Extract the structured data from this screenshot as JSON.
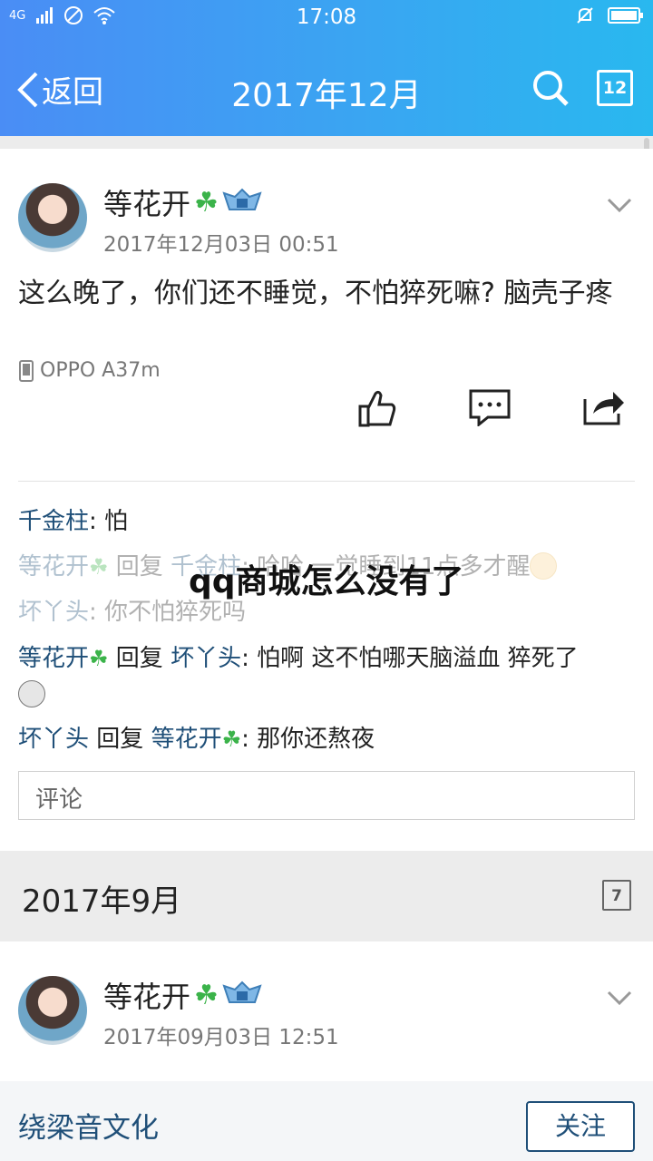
{
  "status_bar": {
    "network": "4G",
    "time": "17:08"
  },
  "nav": {
    "back_label": "返回",
    "title": "2017年12月",
    "calendar_day": "12"
  },
  "post1": {
    "author": "等花开",
    "timestamp": "2017年12月03日 00:51",
    "text": "这么晚了，你们还不睡觉，不怕猝死嘛? 脑壳子疼",
    "device": "OPPO A37m",
    "comments": [
      {
        "author": "千金柱",
        "sep": ": ",
        "text": "怕"
      },
      {
        "author": "等花开",
        "reply_word": "回复",
        "reply_to": "千金柱",
        "sep": ": ",
        "text": "哈哈 一觉睡到11点多才醒"
      },
      {
        "author": "坏丫头",
        "sep": ": ",
        "text": "你不怕猝死吗"
      },
      {
        "author": "等花开",
        "reply_word": "回复",
        "reply_to": "坏丫头",
        "sep": ": ",
        "text": "怕啊 这不怕哪天脑溢血 猝死了"
      },
      {
        "author": "坏丫头",
        "reply_word": "回复",
        "reply_to": "等花开",
        "sep": ": ",
        "text": "那你还熬夜"
      }
    ],
    "comment_placeholder": "评论"
  },
  "month2": {
    "label": "2017年9月",
    "calendar_day": "7"
  },
  "post2": {
    "author": "等花开",
    "timestamp": "2017年09月03日 12:51"
  },
  "overlay_text": "qq商城怎么没有了",
  "footer": {
    "name": "绕梁音文化",
    "follow_label": "关注"
  },
  "colors": {
    "topbar_start": "#4a8df5",
    "topbar_end": "#29b8ef",
    "link": "#1f4f78"
  },
  "icons": [
    "signal-icon",
    "no-sim-icon",
    "wifi-icon",
    "mute-icon",
    "battery-icon",
    "back-chevron-icon",
    "search-icon",
    "calendar-icon",
    "clover-icon",
    "vip-badge-icon",
    "chevron-down-icon",
    "phone-icon",
    "thumbs-up-icon",
    "comment-icon",
    "share-icon",
    "blush-emoji-icon",
    "skull-emoji-icon"
  ]
}
